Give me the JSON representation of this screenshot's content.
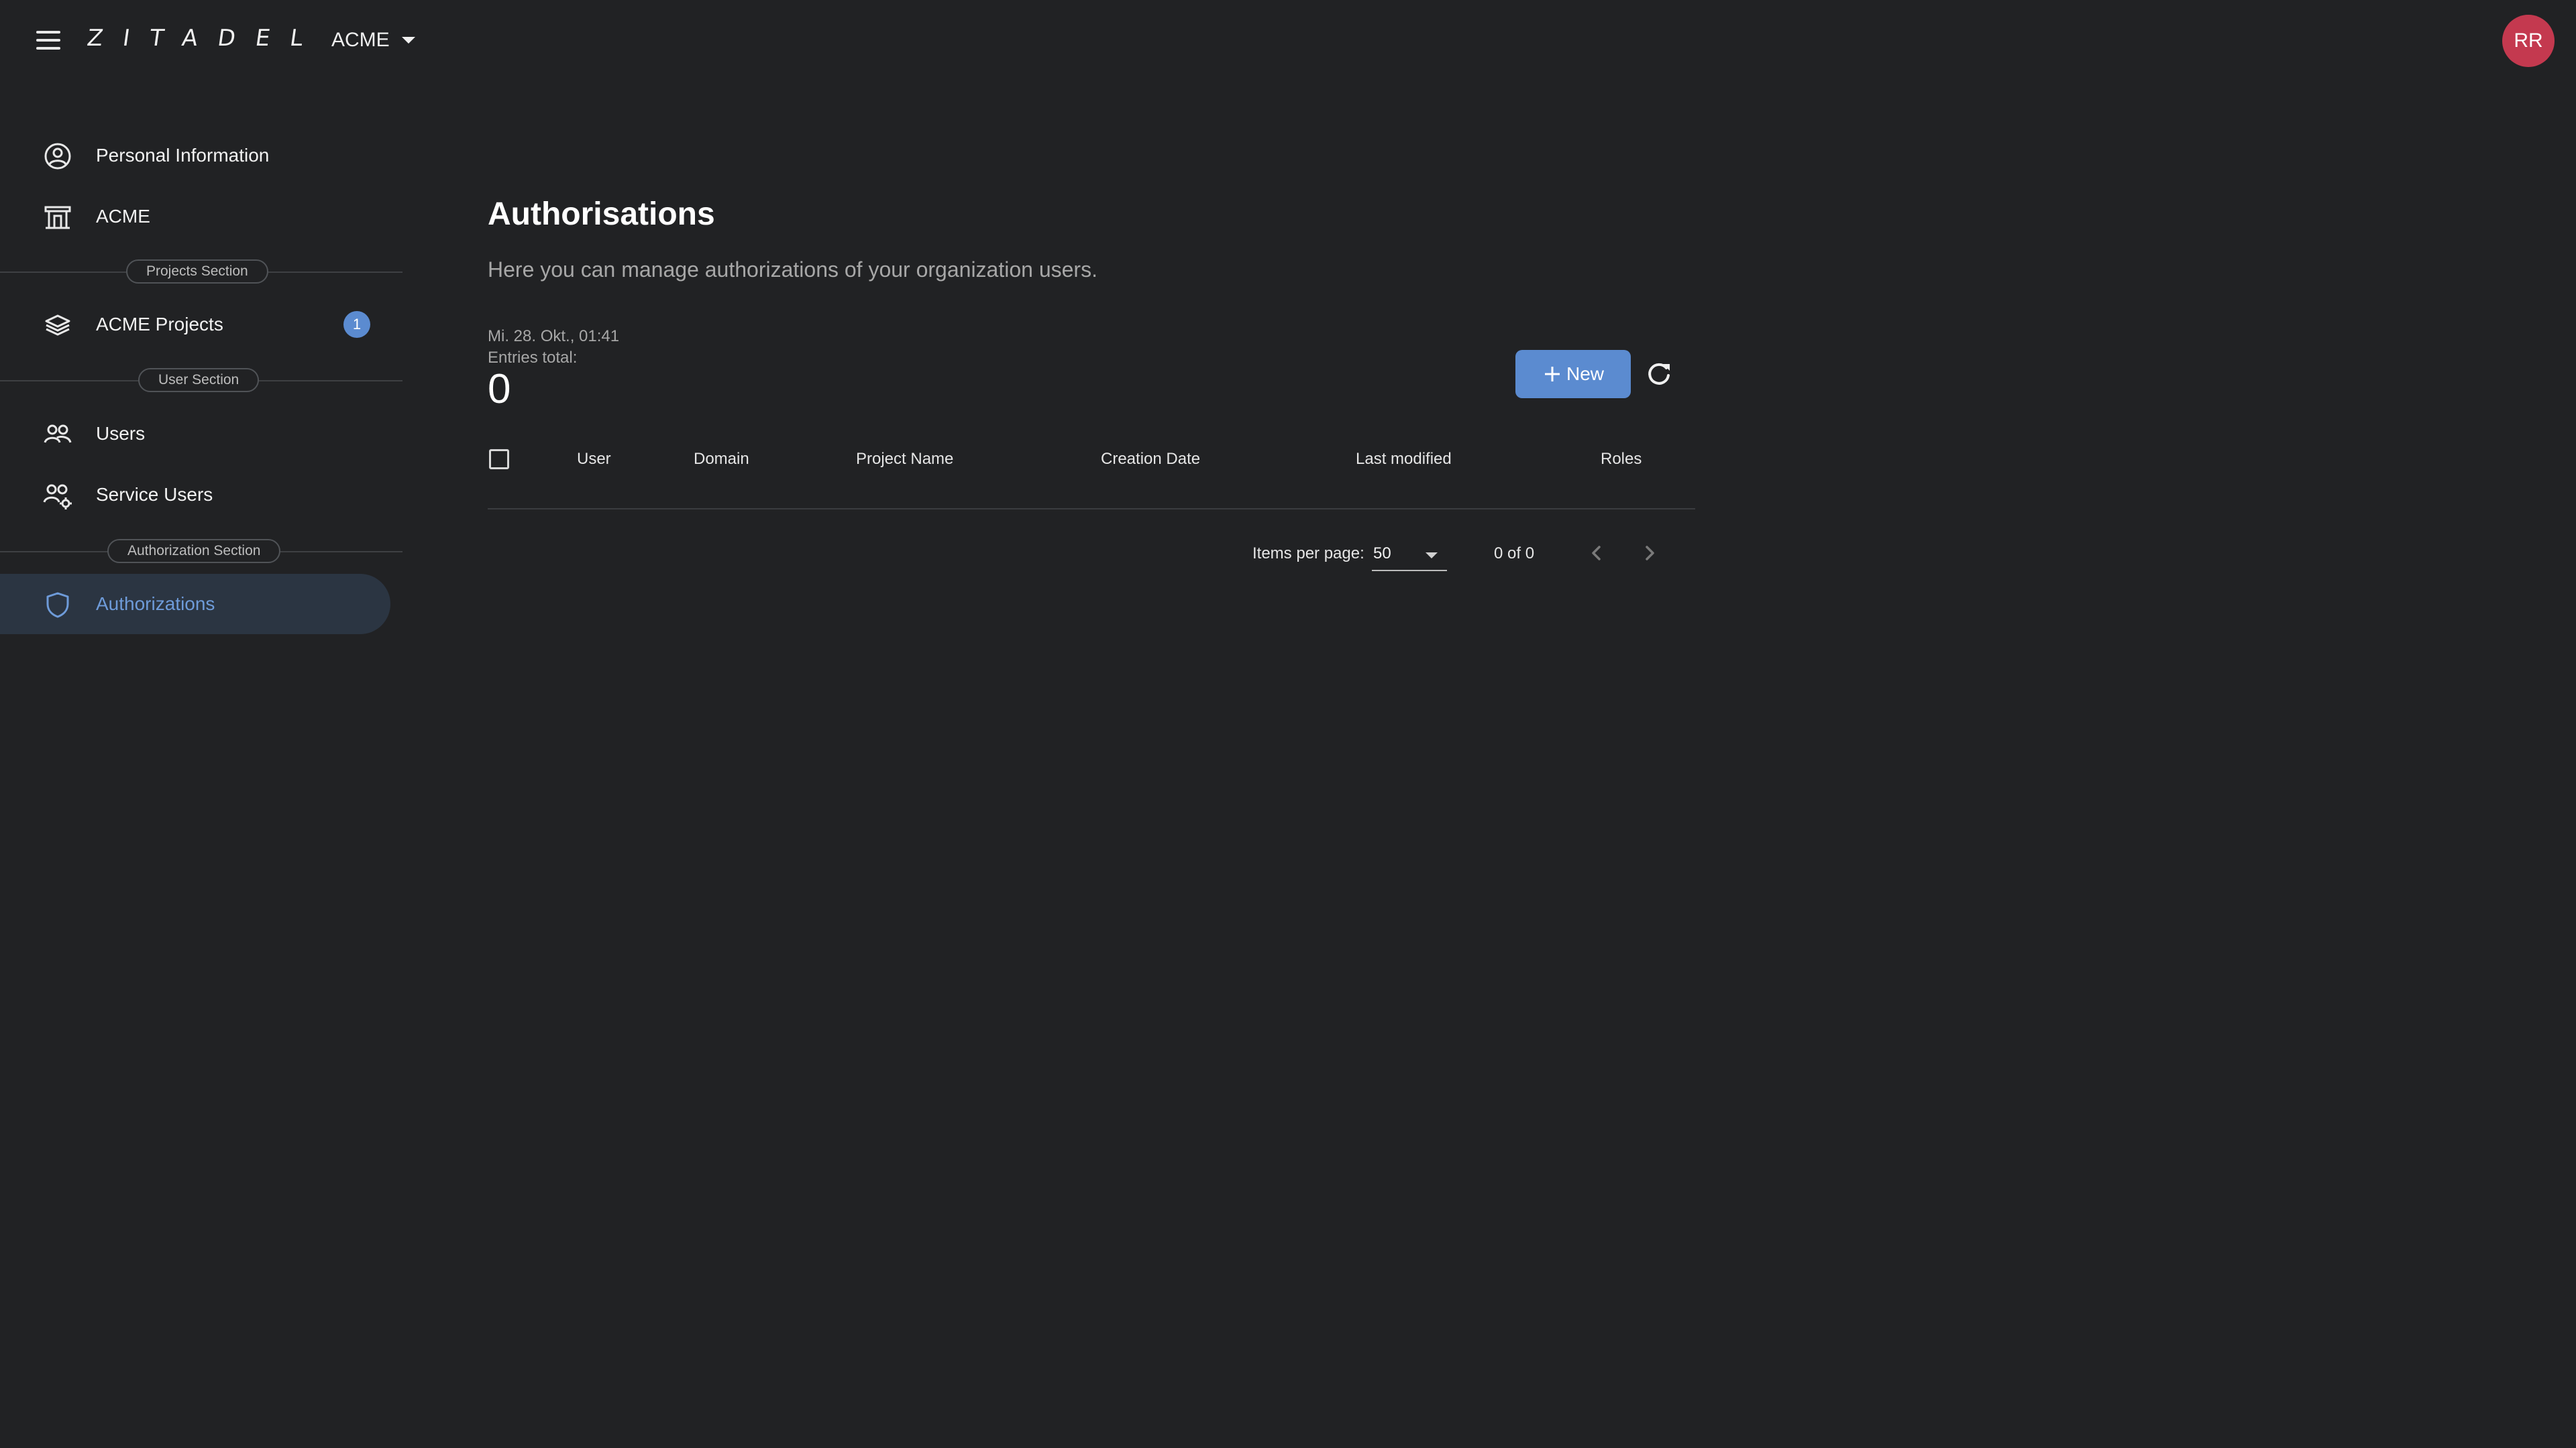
{
  "header": {
    "brand": "ZITADEL",
    "org_name": "ACME",
    "avatar_initials": "RR",
    "avatar_color": "#c4394f"
  },
  "sidebar": {
    "items": [
      {
        "label": "Personal Information",
        "icon": "user-circle-icon"
      },
      {
        "label": "ACME",
        "icon": "organization-icon"
      },
      {
        "label": "ACME Projects",
        "icon": "layers-icon",
        "badge": "1"
      },
      {
        "label": "Users",
        "icon": "users-icon"
      },
      {
        "label": "Service Users",
        "icon": "service-users-icon"
      },
      {
        "label": "Authorizations",
        "icon": "shield-icon",
        "active": true
      }
    ],
    "sections": {
      "projects": "Projects Section",
      "users": "User Section",
      "authorization": "Authorization Section"
    }
  },
  "main": {
    "title": "Authorisations",
    "description": "Here you can manage authorizations of your organization users.",
    "timestamp": "Mi. 28. Okt., 01:41",
    "entries_label": "Entries total:",
    "entries_count": "0",
    "new_button": "New",
    "table": {
      "columns": [
        "User",
        "Domain",
        "Project Name",
        "Creation Date",
        "Last modified",
        "Roles"
      ],
      "rows": []
    },
    "paginator": {
      "items_per_page_label": "Items per page:",
      "items_per_page": "50",
      "range": "0 of 0"
    }
  },
  "colors": {
    "background": "#212224",
    "accent": "#5b8bd0",
    "active_item_bg": "#2b3542",
    "active_item_text": "#6e9bd9"
  }
}
